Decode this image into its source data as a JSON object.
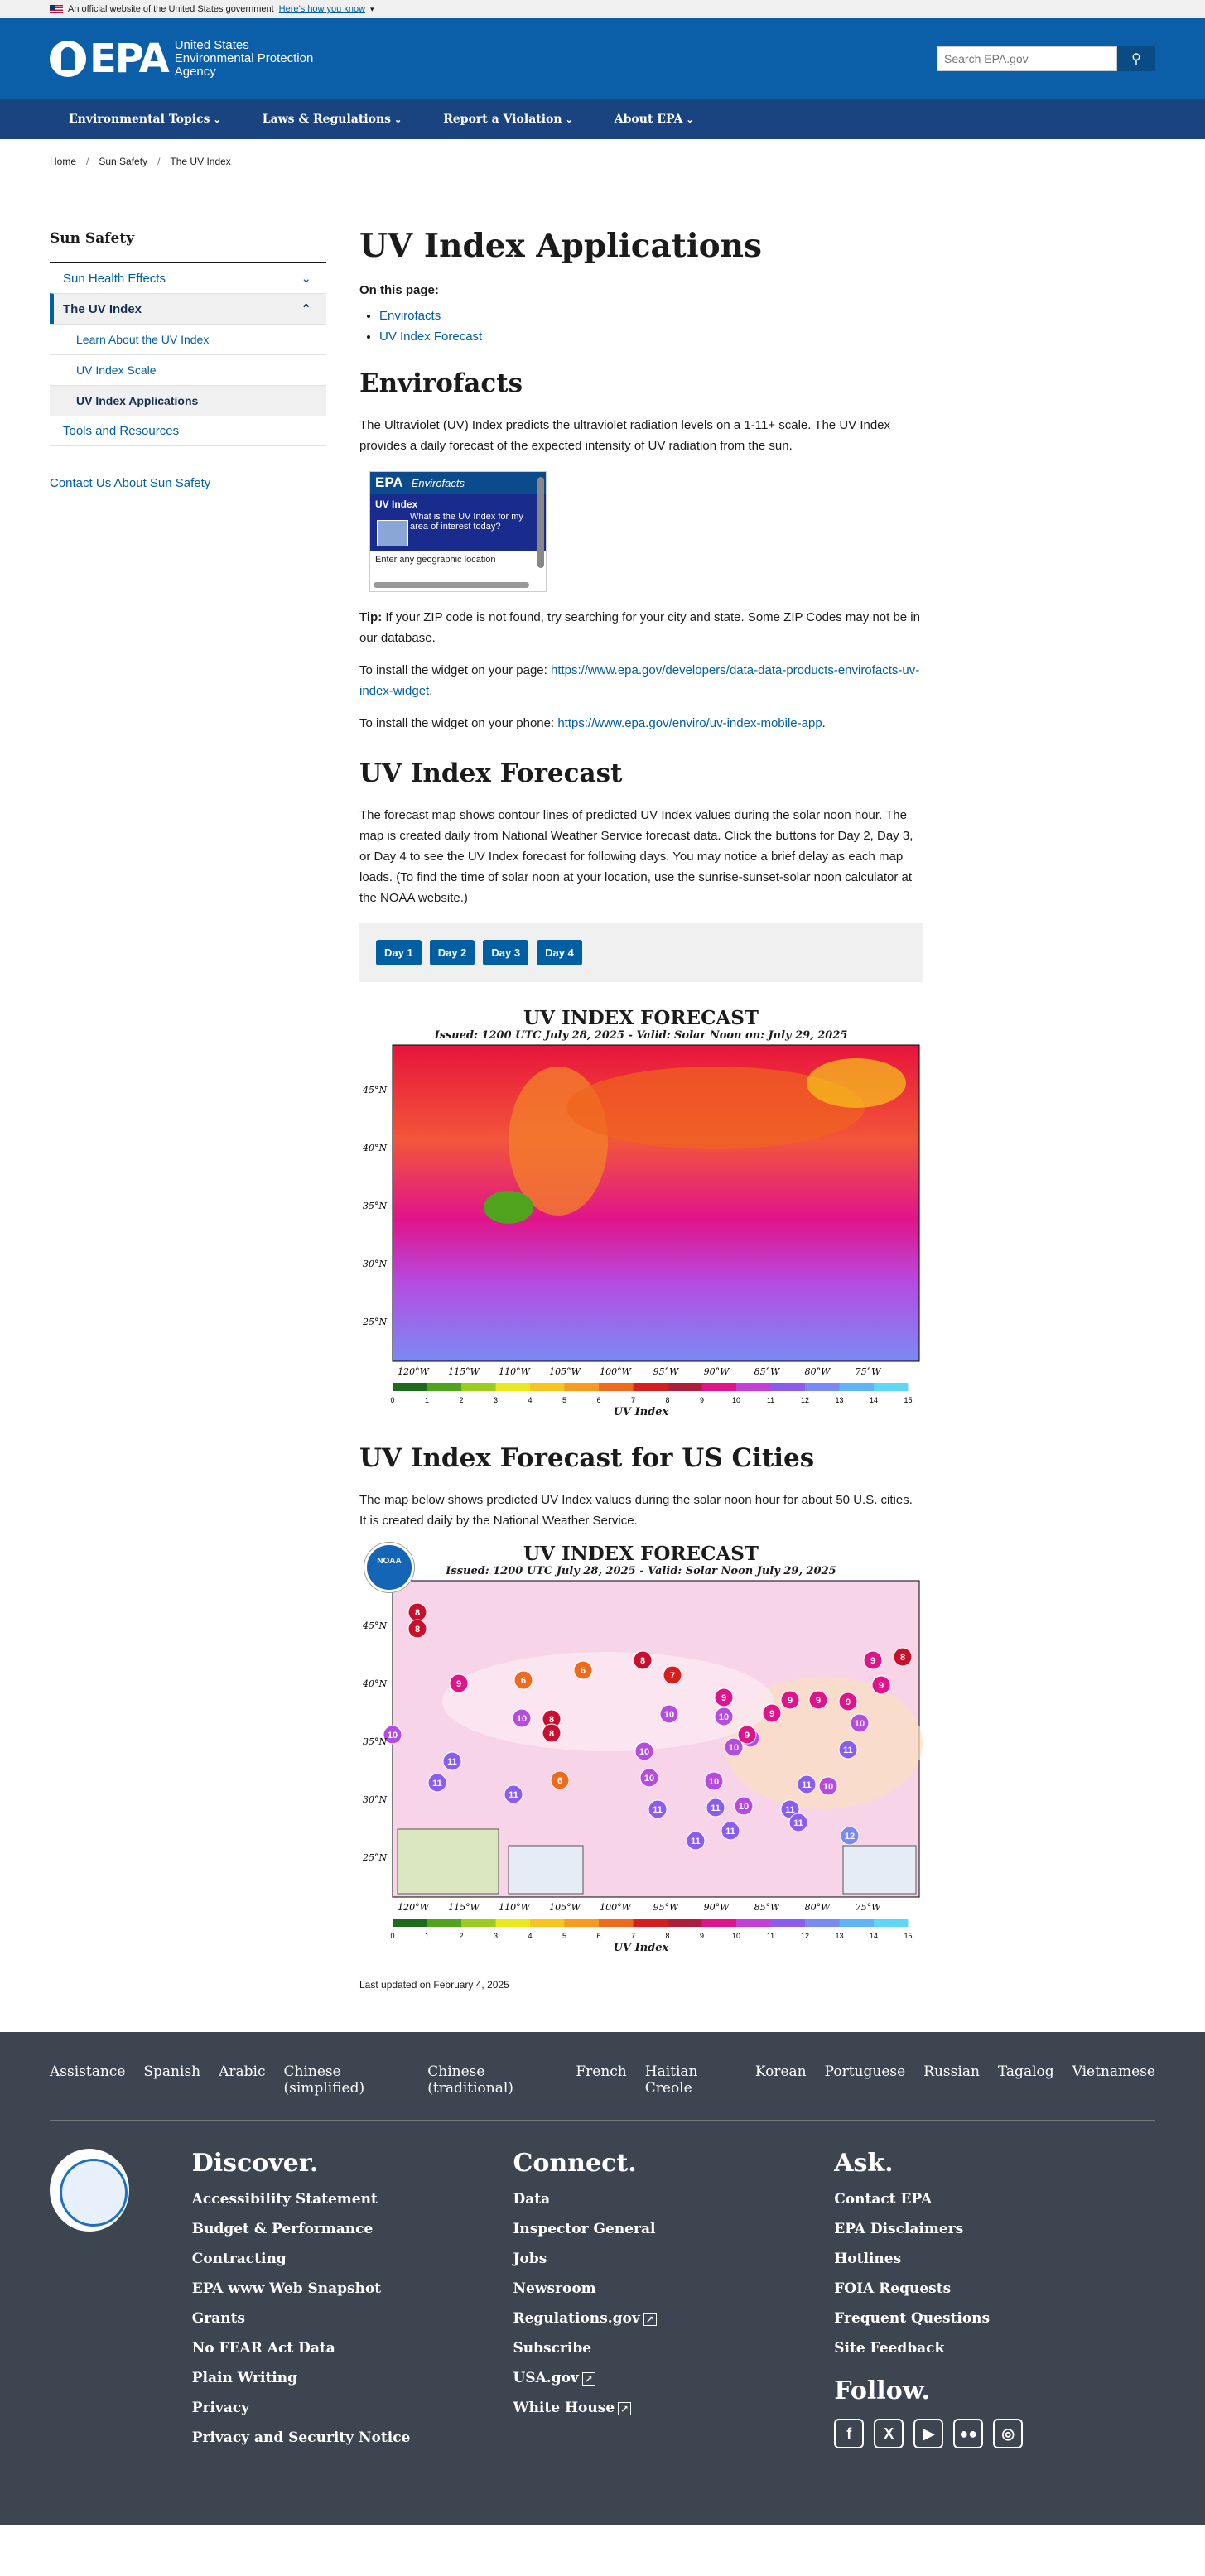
{
  "gov_banner": {
    "text": "An official website of the United States government",
    "link": "Here’s how you know"
  },
  "header": {
    "logo_text": "EPA",
    "agency": [
      "United States",
      "Environmental Protection",
      "Agency"
    ],
    "search_placeholder": "Search EPA.gov"
  },
  "nav": [
    "Environmental Topics",
    "Laws & Regulations",
    "Report a Violation",
    "About EPA"
  ],
  "breadcrumbs": [
    "Home",
    "Sun Safety",
    "The UV Index"
  ],
  "sidebar": {
    "title": "Sun Safety",
    "items": [
      "Sun Health Effects",
      "The UV Index"
    ],
    "sub": [
      "Learn About the UV Index",
      "UV Index Scale",
      "UV Index Applications"
    ],
    "tools": "Tools and Resources",
    "contact": "Contact Us About Sun Safety"
  },
  "main": {
    "title": "UV Index Applications",
    "on_this_page": "On this page:",
    "toc": [
      "Envirofacts",
      "UV Index Forecast"
    ],
    "envirofacts_heading": "Envirofacts",
    "envirofacts_p": "The Ultraviolet (UV) Index predicts the ultraviolet radiation levels on a 1-11+ scale. The UV Index provides a daily forecast of the expected intensity of UV radiation from the sun.",
    "widget": {
      "brand": "EPA",
      "name": "Envirofacts",
      "title": "UV Index",
      "question": "What is the UV Index for my area of interest today?",
      "enter": "Enter any geographic location"
    },
    "tip_label": "Tip:",
    "tip": " If your ZIP code is not found, try searching for your city and state. Some ZIP Codes may not be in our database.",
    "install_page_text": "To install the widget on your page: ",
    "install_page_url": "https://www.epa.gov/developers/data-data-products-envirofacts-uv-index-widget",
    "install_phone_text": "To install the widget on your phone: ",
    "install_phone_url": "https://www.epa.gov/enviro/uv-index-mobile-app",
    "forecast_heading": "UV Index Forecast",
    "forecast_p": "The forecast map shows contour lines of predicted UV Index values during the solar noon hour. The map is created daily from National Weather Service forecast data. Click the buttons for Day 2, Day 3, or Day 4 to see the UV Index forecast for following days. You may notice a brief delay as each map loads. (To find the time of solar noon at your location, use the sunrise-sunset-solar noon calculator at the NOAA website.)",
    "day_buttons": [
      "Day 1",
      "Day 2",
      "Day 3",
      "Day 4"
    ],
    "map_title": "UV INDEX FORECAST",
    "map_subtitle": "Issued: 1200 UTC July 28, 2025 - Valid: Solar Noon on: July 29, 2025",
    "map2_subtitle": "Issued: 1200 UTC July 28, 2025 - Valid: Solar Noon July 29, 2025",
    "lat_labels": [
      "45°N",
      "40°N",
      "35°N",
      "30°N",
      "25°N"
    ],
    "lon_labels": [
      "120°W",
      "115°W",
      "110°W",
      "105°W",
      "100°W",
      "95°W",
      "90°W",
      "85°W",
      "80°W",
      "75°W"
    ],
    "scale_labels": [
      "0",
      "1",
      "2",
      "3",
      "4",
      "5",
      "6",
      "7",
      "8",
      "9",
      "10",
      "11",
      "12",
      "13",
      "14",
      "15"
    ],
    "scale_title": "UV Index",
    "cities_heading": "UV Index Forecast for US Cities",
    "cities_p": "The map below shows predicted UV Index values during the solar noon hour for about 50 U.S. cities. It is created daily by the National Weather Service.",
    "noaa": "NOAA",
    "updated": "Last updated on February 4, 2025"
  },
  "colors": {
    "scale": [
      "#1d6b1d",
      "#4fa31d",
      "#9ccc1d",
      "#e8e81d",
      "#f7c51d",
      "#f79a1d",
      "#ef6a1d",
      "#d81d1d",
      "#b01d3a",
      "#e0148a",
      "#c43fd8",
      "#8b5cf0",
      "#7a8af5",
      "#5fb4f7",
      "#5fd8f7"
    ]
  },
  "footer": {
    "languages": [
      "Assistance",
      "Spanish",
      "Arabic",
      "Chinese (simplified)",
      "Chinese (traditional)",
      "French",
      "Haitian Creole",
      "Korean",
      "Portuguese",
      "Russian",
      "Tagalog",
      "Vietnamese"
    ],
    "discover": {
      "title": "Discover.",
      "links": [
        "Accessibility Statement",
        "Budget & Performance",
        "Contracting",
        "EPA www Web Snapshot",
        "Grants",
        "No FEAR Act Data",
        "Plain Writing",
        "Privacy",
        "Privacy and Security Notice"
      ]
    },
    "connect": {
      "title": "Connect.",
      "links": [
        "Data",
        "Inspector General",
        "Jobs",
        "Newsroom",
        "Regulations.gov",
        "Subscribe",
        "USA.gov",
        "White House"
      ]
    },
    "ask": {
      "title": "Ask.",
      "links": [
        "Contact EPA",
        "EPA Disclaimers",
        "Hotlines",
        "FOIA Requests",
        "Frequent Questions",
        "Site Feedback"
      ]
    },
    "follow": "Follow.",
    "social": [
      "facebook-icon",
      "x-icon",
      "youtube-icon",
      "flickr-icon",
      "instagram-icon"
    ]
  }
}
